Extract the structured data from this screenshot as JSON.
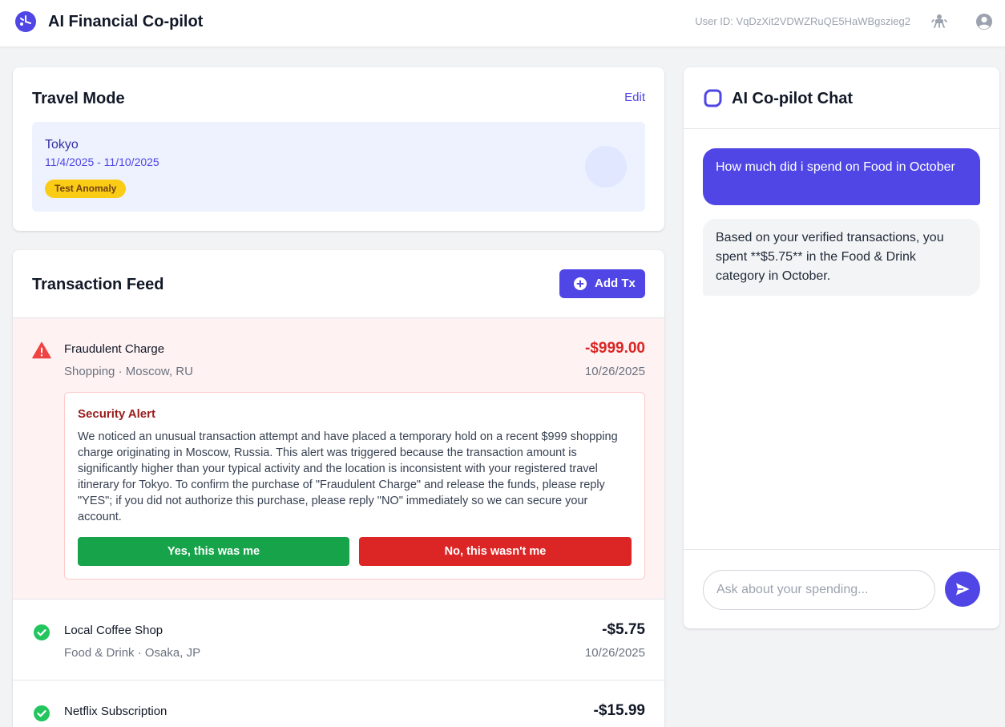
{
  "header": {
    "title": "AI Financial Co-pilot",
    "user_id_label": "User ID: ",
    "user_id_value": "VqDzXit2VDWZRuQE5HaWBgszieg2",
    "logo_icon": "pie-chart-logo-icon",
    "settings_icon": "puzzle-icon",
    "avatar_icon": "user-circle-icon"
  },
  "travel": {
    "title": "Travel Mode",
    "edit_label": "Edit",
    "city": "Tokyo",
    "dates": "11/4/2025 - 11/10/2025",
    "badge": "Test Anomaly"
  },
  "feed": {
    "title": "Transaction Feed",
    "add_label": "Add Tx",
    "transactions": [
      {
        "name": "Fraudulent Charge",
        "category": "Shopping",
        "separator": " · ",
        "location": "Moscow, RU",
        "amount": "-$999.00",
        "date": "10/26/2025",
        "status": "flagged",
        "status_icon": "warning-triangle-icon",
        "alert": {
          "title": "Security Alert",
          "body": "We noticed an unusual transaction attempt and have placed a temporary hold on a recent $999 shopping charge originating in Moscow, Russia. This alert was triggered because the transaction amount is significantly higher than your typical activity and the location is inconsistent with your registered travel itinerary for Tokyo. To confirm the purchase of \"Fraudulent Charge\" and release the funds, please reply \"YES\"; if you did not authorize this purchase, please reply \"NO\" immediately so we can secure your account.",
          "yes_label": "Yes, this was me",
          "no_label": "No, this wasn't me"
        }
      },
      {
        "name": "Local Coffee Shop",
        "category": "Food & Drink",
        "separator": " · ",
        "location": "Osaka, JP",
        "amount": "-$5.75",
        "date": "10/26/2025",
        "status": "verified",
        "status_icon": "check-circle-icon"
      },
      {
        "name": "Netflix Subscription",
        "amount": "-$15.99",
        "status": "verified",
        "status_icon": "check-circle-icon"
      }
    ]
  },
  "chat": {
    "title": "AI Co-pilot Chat",
    "messages": [
      {
        "role": "user",
        "text": "How much did i spend on Food in October"
      },
      {
        "role": "assistant",
        "text": "Based on your verified transactions, you spent **$5.75** in the Food & Drink category in October."
      }
    ],
    "input_placeholder": "Ask about your spending...",
    "send_icon": "send-icon"
  },
  "colors": {
    "accent": "#4f46e5",
    "danger": "#dc2626",
    "success": "#16a34a",
    "badge": "#facc15"
  }
}
